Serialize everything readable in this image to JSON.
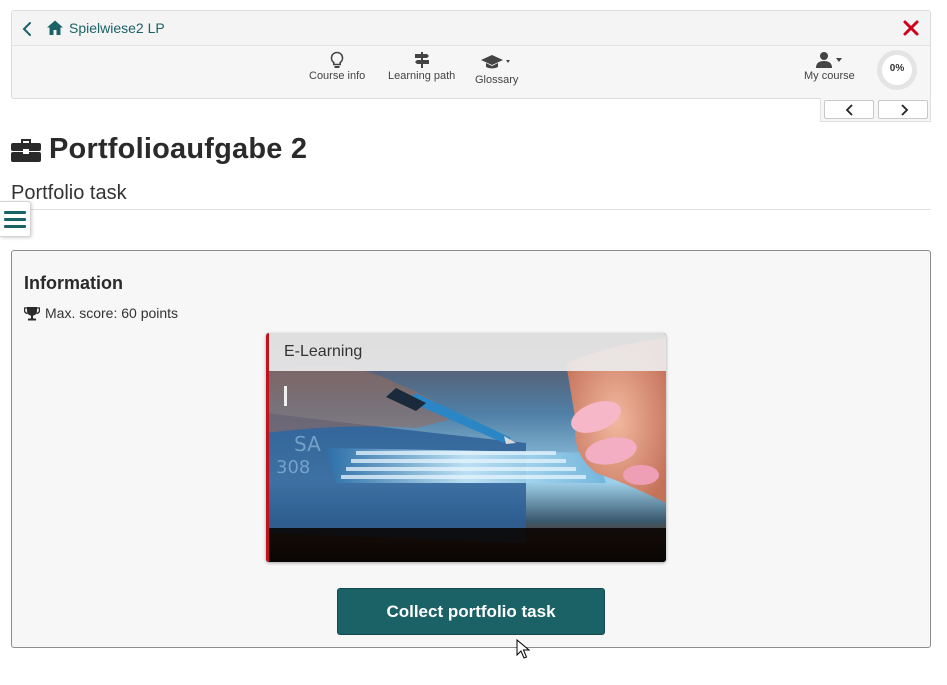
{
  "header": {
    "breadcrumb_title": "Spielwiese2 LP"
  },
  "toolbar": {
    "course_info": "Course info",
    "learning_path": "Learning path",
    "glossary": "Glossary",
    "my_course": "My course",
    "progress": "0%"
  },
  "page": {
    "title": "Portfolioaufgabe 2",
    "subtitle": "Portfolio task"
  },
  "info": {
    "heading": "Information",
    "max_score": "Max. score: 60 points",
    "tile_label": "E-Learning",
    "collect_button": "Collect portfolio task"
  },
  "colors": {
    "brand_teal": "#1b6266",
    "close_red": "#d0021b",
    "tile_accent": "#c0141d"
  },
  "icons": [
    "chevron-left-icon",
    "home-icon",
    "close-icon",
    "lightbulb-icon",
    "signpost-icon",
    "graduation-cap-icon",
    "user-icon",
    "chevron-right-icon",
    "briefcase-icon",
    "hamburger-icon",
    "trophy-icon",
    "mouse-cursor-icon"
  ]
}
